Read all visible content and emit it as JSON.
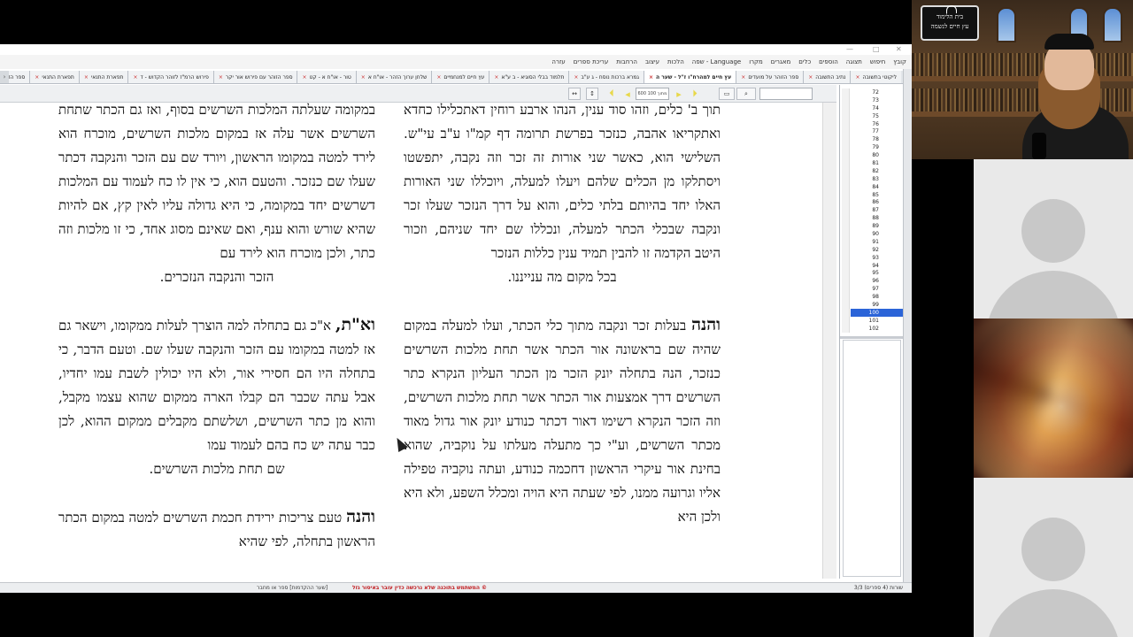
{
  "window": {
    "controls": [
      "—",
      "□",
      "✕"
    ]
  },
  "menubar": {
    "items": [
      "קובץ",
      "חיפוש",
      "תצוגה",
      "הוספים",
      "כלים",
      "מאגרים",
      "מקרו",
      "Language - שפה",
      "הלכות",
      "עיצוב",
      "הרחבות",
      "עריכת ספרים",
      "עזרה"
    ]
  },
  "tabs": [
    {
      "label": "ליקוטי בתשובה",
      "active": false
    },
    {
      "label": "נתיב התשובה",
      "active": false
    },
    {
      "label": "ספר הזוהר על מועדים",
      "active": false
    },
    {
      "label": "עץ חיים למהרח\"ו ז\"ל - שער ה",
      "active": true
    },
    {
      "label": "גמרא ברכות נוסח - ג ע\"ב",
      "active": false
    },
    {
      "label": "תלמוד בבלי הסוגיא - ב ע\"א",
      "active": false
    },
    {
      "label": "עץ חיים למנחמיים",
      "active": false
    },
    {
      "label": "שלחן ערוך הזהר - או\"ח א",
      "active": false
    },
    {
      "label": "טור - או\"ח א - קט",
      "active": false
    },
    {
      "label": "ספר הזוהר עם פירוש אור יקר",
      "active": false
    },
    {
      "label": "פירוש הרמ\"ז לזוהר הקדוש - ד",
      "active": false
    },
    {
      "label": "תפארת התנאי",
      "active": false
    },
    {
      "label": "תפארת התנאי",
      "active": false
    },
    {
      "label": "ספר הזוהר עם פירוש אור יקר",
      "active": false
    }
  ],
  "toolbar": {
    "page_field": "600 מתוך 100"
  },
  "document": {
    "right_column": [
      {
        "type": "p",
        "text": "תוך ב' כלים, וזהו סוד ענין, הנהו ארבע רוחין דאתכלילו כחדא ואתקריאו אהבה, כנזכר בפרשת תרומה דף קמ\"ו ע\"ב עי\"ש. השלישי הוא, כאשר שני אורות זה זכר וזה נקבה, יתפשטו ויסתלקו מן הכלים שלהם ויעלו למעלה, ויוכללו שני האורות האלו יחד בהיותם בלתי כלים, והוא על דרך הנזכר שעלו זכר ונקבה שבכלי הכתר למעלה, ונכללו שם יחד שניהם, וזכור היטב הקדמה זו להבין תמיד ענין כללות הנזכר"
      },
      {
        "type": "center",
        "text": "בכל מקום מה ענייננו."
      },
      {
        "type": "gap"
      },
      {
        "type": "lead",
        "lead": "והנה",
        "text": " בעלות זכר ונקבה מתוך כלי הכתר, ועלו למעלה במקום שהיה שם בראשונה אור הכתר אשר תחת מלכות השרשים כנזכר, הנה בתחלה יונק הזכר מן הכתר העליון הנקרא כתר השרשים דרך אמצעות אור הכתר אשר תחת מלכות השרשים, וזה הזכר הנקרא רשימו דאור דכתר כנודע יונק אור גדול מאוד מכתר השרשים, וע\"י כך מתעלה מעלתו על נוקביה, שהוא בחינת אור עיקרי הראשון דחכמה כנודע, ועתה נוקביה טפילה אליו וגרועה ממנו, לפי שעתה היא הויה ומכלל השפע, ולא היא ולכן היא"
      }
    ],
    "left_column": [
      {
        "type": "p",
        "text": "במקומה שעלתה המלכות השרשים בסוף, ואז גם הכתר שתחת השרשים אשר עלה אז במקום מלכות השרשים, מוכרח הוא לירד למטה במקומו הראשון, ויורד שם עם הזכר והנקבה דכתר שעלו שם כנזכר. והטעם הוא, כי אין לו כח לעמוד עם המלכות דשרשים יחד במקומה, כי היא גדולה עליו לאין קץ, אם להיות שהיא שורש והוא ענף, ואם שאינם מסוג אחד, כי זו מלכות וזה כתר, ולכן מוכרח הוא לירד עם"
      },
      {
        "type": "center",
        "text": "הזכר והנקבה הנזכרים."
      },
      {
        "type": "gap"
      },
      {
        "type": "lead",
        "lead": "וא\"ת,",
        "text": " א\"כ גם בתחלה למה הוצרך לעלות ממקומו, וישאר גם אז למטה במקומו עם הזכר והנקבה שעלו שם. וטעם הדבר, כי בתחלה היו הם חסירי אור, ולא היו יכולין לשבת עמו יחדיו, אבל עתה שכבר הם קבלו הארה ממקום שהוא עצמו מקבל, והוא מן כתר השרשים, ושלשתם מקבלים ממקום ההוא, לכן כבר עתה יש כח בהם לעמוד עמו"
      },
      {
        "type": "center",
        "text": "שם תחת מלכות השרשים."
      },
      {
        "type": "gap"
      },
      {
        "type": "lead",
        "lead": "והנה",
        "text": " טעם צריכות ירידת חכמת השרשים למטה במקום הכתר הראשון בתחלה, לפי שהיא"
      }
    ]
  },
  "pagelist": {
    "pages": [
      "72",
      "73",
      "74",
      "75",
      "76",
      "77",
      "78",
      "79",
      "80",
      "81",
      "82",
      "83",
      "84",
      "85",
      "86",
      "87",
      "88",
      "89",
      "90",
      "91",
      "92",
      "93",
      "94",
      "95",
      "96",
      "97",
      "98",
      "99",
      "100",
      "101",
      "102"
    ],
    "selected": "100"
  },
  "statusbar": {
    "right": "שורות (4 ספרים) 3/3",
    "mid": "© המשתמש בתוכנה שלא נרכשה כדין עובר באיסור גזל",
    "left": "[שער ההקדמות] ספר או מחבר"
  },
  "participants": {
    "speaker_logo": [
      "בית הלימוד",
      "עץ חיים לנשמה"
    ]
  }
}
